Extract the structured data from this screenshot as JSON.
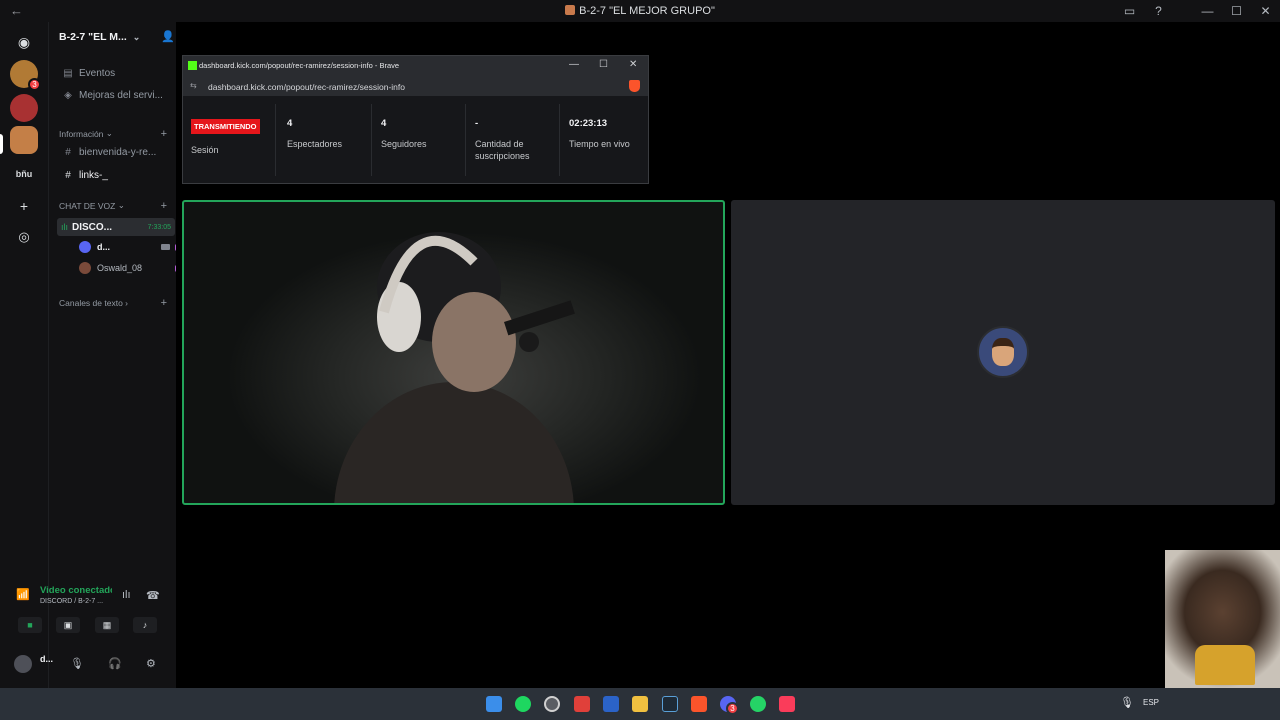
{
  "window": {
    "title": "B-2-7 \"EL MEJOR GRUPO\""
  },
  "server": {
    "name": "B-2-7 \"EL M...",
    "items": [
      {
        "icon": "calendar-icon",
        "label": "Eventos"
      },
      {
        "icon": "boost-icon",
        "label": "Mejoras del servi..."
      }
    ],
    "categories": {
      "info": "Información",
      "voice": "CHAT DE VOZ",
      "text": "Canales de texto"
    },
    "text_channels": [
      {
        "label": "bienvenida-y-re..."
      },
      {
        "label": "links-_"
      }
    ],
    "voice_channel": {
      "label": "DISCO...",
      "time": "7:33:05",
      "users": [
        {
          "name": "d..."
        },
        {
          "name": "Oswald_08"
        }
      ]
    },
    "rail_badge": "3",
    "rail_text": "bñu"
  },
  "voice_connection": {
    "status": "Video conectado",
    "subtitle": "DISCORD / B-2-7 ..."
  },
  "user": {
    "name": "d..."
  },
  "popup": {
    "window_title": "dashboard.kick.com/popout/rec-ramirez/session-info - Brave",
    "url": "dashboard.kick.com/popout/rec-ramirez/session-info",
    "live_badge": "TRANSMITIENDO",
    "session_label": "Sesión",
    "stats": [
      {
        "value": "4",
        "label": "Espectadores"
      },
      {
        "value": "4",
        "label": "Seguidores"
      },
      {
        "value": "-",
        "label": "Cantidad de suscripciones"
      },
      {
        "value": "02:23:13",
        "label": "Tiempo en vivo"
      }
    ]
  },
  "taskbar": {
    "lang": "ESP",
    "apps": [
      "windows-start-icon",
      "spotify-icon",
      "obs-icon",
      "pdf-icon",
      "word-icon",
      "file-explorer-icon",
      "davinci-icon",
      "brave-icon",
      "discord-icon",
      "whatsapp-icon",
      "itunes-icon"
    ],
    "discord_badge": "3"
  },
  "colors": {
    "discord_bg": "#121214",
    "accent_green": "#23a55a",
    "kick_green": "#53fc18",
    "live_red": "#e5161b"
  }
}
